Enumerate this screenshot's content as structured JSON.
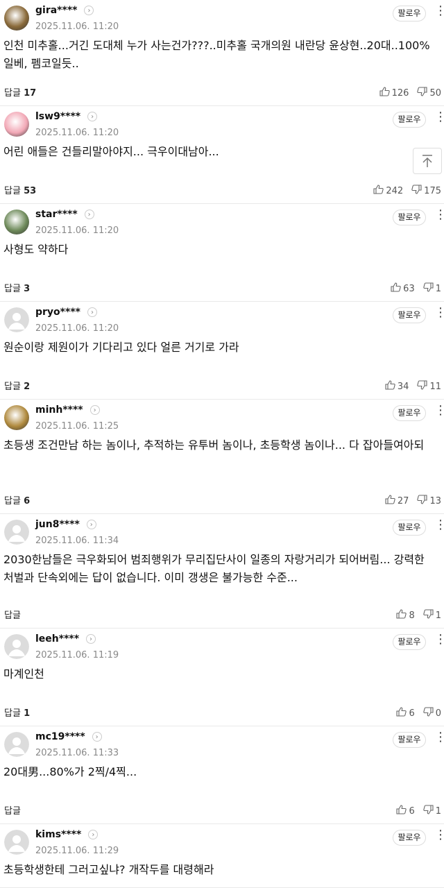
{
  "follow_label": "팔로우",
  "reply_label": "답글",
  "comments": [
    {
      "user": "gira****",
      "time": "2025.11.06. 11:20",
      "text": "인천 미추홀...거긴 도대체 누가 사는건가???..미추홀 국개의원 내란당 윤상현..20대..100% 일베, 펨코일듯..",
      "replies": "17",
      "likes": "126",
      "dislikes": "50",
      "avatar_color": "#8a6a3a"
    },
    {
      "user": "lsw9****",
      "time": "2025.11.06. 11:20",
      "text": "어린 애들은 건들리말아야지... 극우이대남아...",
      "replies": "53",
      "likes": "242",
      "dislikes": "175",
      "avatar_color": "#f2a8b6"
    },
    {
      "user": "star****",
      "time": "2025.11.06. 11:20",
      "text": "사형도 약하다",
      "replies": "3",
      "likes": "63",
      "dislikes": "1",
      "avatar_color": "#6e8a5a"
    },
    {
      "user": "pryo****",
      "time": "2025.11.06. 11:20",
      "text": "원순이랑 제원이가 기다리고 있다 얼른 거기로 가라",
      "replies": "2",
      "likes": "34",
      "dislikes": "11",
      "avatar_color": "#d9d9d9"
    },
    {
      "user": "minh****",
      "time": "2025.11.06. 11:25",
      "text": "초등생 조건만남 하는 놈이나, 추적하는 유투버 놈이나, 초등학생 놈이나... 다 잡아들여아되",
      "replies": "6",
      "likes": "27",
      "dislikes": "13",
      "avatar_color": "#b08a3e"
    },
    {
      "user": "jun8****",
      "time": "2025.11.06. 11:34",
      "text": "2030한남들은 극우화되어 범죄행위가 무리집단사이 일종의 자랑거리가 되어버림... 강력한 처벌과 단속외에는 답이 없습니다. 이미 갱생은 불가능한 수준...",
      "replies": "",
      "likes": "8",
      "dislikes": "1",
      "avatar_color": "#d9d9d9"
    },
    {
      "user": "leeh****",
      "time": "2025.11.06. 11:19",
      "text": "마계인천",
      "replies": "1",
      "likes": "6",
      "dislikes": "0",
      "avatar_color": "#d9d9d9"
    },
    {
      "user": "mc19****",
      "time": "2025.11.06. 11:33",
      "text": "20대男...80%가 2찍/4찍...",
      "replies": "",
      "likes": "6",
      "dislikes": "1",
      "avatar_color": "#d9d9d9"
    },
    {
      "user": "kims****",
      "time": "2025.11.06. 11:29",
      "text": "초등학생한테 그러고싶냐? 개작두를 대령해라",
      "replies": "",
      "likes": "",
      "dislikes": "",
      "avatar_color": "#d9d9d9"
    }
  ],
  "icons": {
    "more": "more-vertical-icon",
    "like": "thumbs-up-icon",
    "dislike": "thumbs-down-icon",
    "top": "scroll-to-top-icon"
  }
}
